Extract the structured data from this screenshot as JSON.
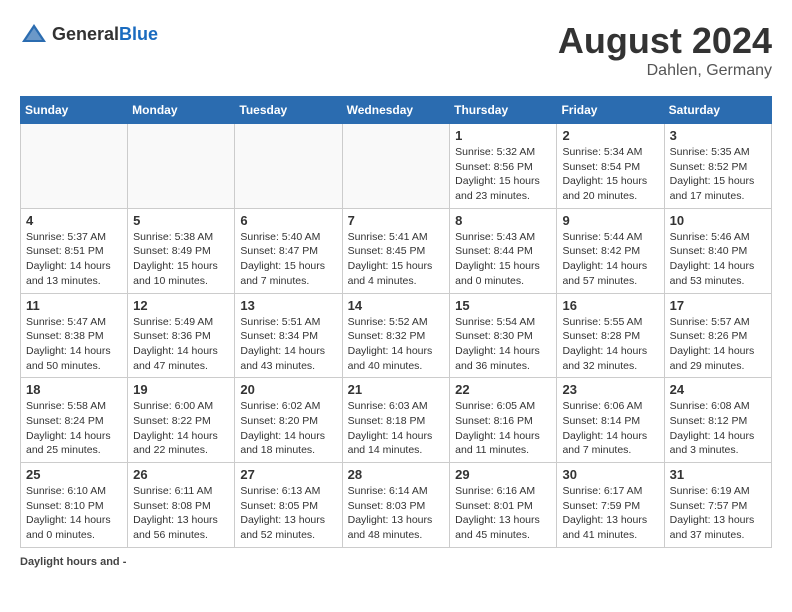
{
  "header": {
    "logo_general": "General",
    "logo_blue": "Blue",
    "month_year": "August 2024",
    "location": "Dahlen, Germany"
  },
  "days_of_week": [
    "Sunday",
    "Monday",
    "Tuesday",
    "Wednesday",
    "Thursday",
    "Friday",
    "Saturday"
  ],
  "weeks": [
    [
      {
        "day": "",
        "empty": true
      },
      {
        "day": "",
        "empty": true
      },
      {
        "day": "",
        "empty": true
      },
      {
        "day": "",
        "empty": true
      },
      {
        "day": "1",
        "sunrise": "5:32 AM",
        "sunset": "8:56 PM",
        "daylight": "15 hours and 23 minutes."
      },
      {
        "day": "2",
        "sunrise": "5:34 AM",
        "sunset": "8:54 PM",
        "daylight": "15 hours and 20 minutes."
      },
      {
        "day": "3",
        "sunrise": "5:35 AM",
        "sunset": "8:52 PM",
        "daylight": "15 hours and 17 minutes."
      }
    ],
    [
      {
        "day": "4",
        "sunrise": "5:37 AM",
        "sunset": "8:51 PM",
        "daylight": "14 hours and 13 minutes."
      },
      {
        "day": "5",
        "sunrise": "5:38 AM",
        "sunset": "8:49 PM",
        "daylight": "15 hours and 10 minutes."
      },
      {
        "day": "6",
        "sunrise": "5:40 AM",
        "sunset": "8:47 PM",
        "daylight": "15 hours and 7 minutes."
      },
      {
        "day": "7",
        "sunrise": "5:41 AM",
        "sunset": "8:45 PM",
        "daylight": "15 hours and 4 minutes."
      },
      {
        "day": "8",
        "sunrise": "5:43 AM",
        "sunset": "8:44 PM",
        "daylight": "15 hours and 0 minutes."
      },
      {
        "day": "9",
        "sunrise": "5:44 AM",
        "sunset": "8:42 PM",
        "daylight": "14 hours and 57 minutes."
      },
      {
        "day": "10",
        "sunrise": "5:46 AM",
        "sunset": "8:40 PM",
        "daylight": "14 hours and 53 minutes."
      }
    ],
    [
      {
        "day": "11",
        "sunrise": "5:47 AM",
        "sunset": "8:38 PM",
        "daylight": "14 hours and 50 minutes."
      },
      {
        "day": "12",
        "sunrise": "5:49 AM",
        "sunset": "8:36 PM",
        "daylight": "14 hours and 47 minutes."
      },
      {
        "day": "13",
        "sunrise": "5:51 AM",
        "sunset": "8:34 PM",
        "daylight": "14 hours and 43 minutes."
      },
      {
        "day": "14",
        "sunrise": "5:52 AM",
        "sunset": "8:32 PM",
        "daylight": "14 hours and 40 minutes."
      },
      {
        "day": "15",
        "sunrise": "5:54 AM",
        "sunset": "8:30 PM",
        "daylight": "14 hours and 36 minutes."
      },
      {
        "day": "16",
        "sunrise": "5:55 AM",
        "sunset": "8:28 PM",
        "daylight": "14 hours and 32 minutes."
      },
      {
        "day": "17",
        "sunrise": "5:57 AM",
        "sunset": "8:26 PM",
        "daylight": "14 hours and 29 minutes."
      }
    ],
    [
      {
        "day": "18",
        "sunrise": "5:58 AM",
        "sunset": "8:24 PM",
        "daylight": "14 hours and 25 minutes."
      },
      {
        "day": "19",
        "sunrise": "6:00 AM",
        "sunset": "8:22 PM",
        "daylight": "14 hours and 22 minutes."
      },
      {
        "day": "20",
        "sunrise": "6:02 AM",
        "sunset": "8:20 PM",
        "daylight": "14 hours and 18 minutes."
      },
      {
        "day": "21",
        "sunrise": "6:03 AM",
        "sunset": "8:18 PM",
        "daylight": "14 hours and 14 minutes."
      },
      {
        "day": "22",
        "sunrise": "6:05 AM",
        "sunset": "8:16 PM",
        "daylight": "14 hours and 11 minutes."
      },
      {
        "day": "23",
        "sunrise": "6:06 AM",
        "sunset": "8:14 PM",
        "daylight": "14 hours and 7 minutes."
      },
      {
        "day": "24",
        "sunrise": "6:08 AM",
        "sunset": "8:12 PM",
        "daylight": "14 hours and 3 minutes."
      }
    ],
    [
      {
        "day": "25",
        "sunrise": "6:10 AM",
        "sunset": "8:10 PM",
        "daylight": "14 hours and 0 minutes."
      },
      {
        "day": "26",
        "sunrise": "6:11 AM",
        "sunset": "8:08 PM",
        "daylight": "13 hours and 56 minutes."
      },
      {
        "day": "27",
        "sunrise": "6:13 AM",
        "sunset": "8:05 PM",
        "daylight": "13 hours and 52 minutes."
      },
      {
        "day": "28",
        "sunrise": "6:14 AM",
        "sunset": "8:03 PM",
        "daylight": "13 hours and 48 minutes."
      },
      {
        "day": "29",
        "sunrise": "6:16 AM",
        "sunset": "8:01 PM",
        "daylight": "13 hours and 45 minutes."
      },
      {
        "day": "30",
        "sunrise": "6:17 AM",
        "sunset": "7:59 PM",
        "daylight": "13 hours and 41 minutes."
      },
      {
        "day": "31",
        "sunrise": "6:19 AM",
        "sunset": "7:57 PM",
        "daylight": "13 hours and 37 minutes."
      }
    ]
  ],
  "footer": {
    "label": "Daylight hours",
    "text": "and -"
  }
}
